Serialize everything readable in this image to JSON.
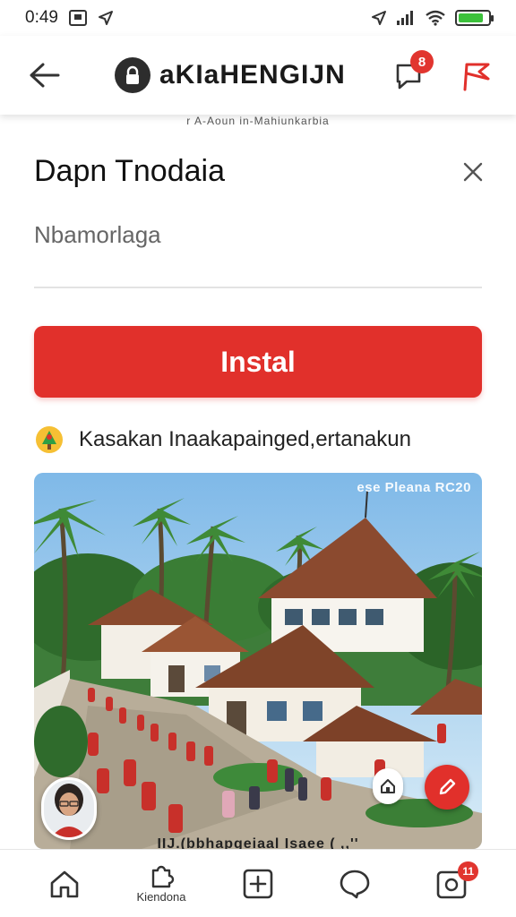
{
  "status_bar": {
    "time": "0:49",
    "icons": [
      "notification-icon",
      "location-arrow-icon"
    ],
    "right_icons": [
      "location-arrow-icon",
      "signal-icon",
      "wifi-icon",
      "battery-icon"
    ],
    "battery_level": 0.85
  },
  "app_bar": {
    "title": "aKIaHENGIJN",
    "back_icon": "arrow-left-icon",
    "notification_badge": "8",
    "actions": [
      "chat-icon",
      "flag-icon"
    ]
  },
  "subheader": {
    "text": "r A-Aoun in-Mahiunkarbia"
  },
  "dialog": {
    "title": "Dapn Tnodaia",
    "subtitle": "Nbamorlaga",
    "install_label": "Instal",
    "info_text": "Kasakan Inaakapainged,ertanakun"
  },
  "image_card": {
    "watermark": "ese Pleana RC20",
    "caption": "IIJ.(bbhapgeiaal Isaee ( ,,''"
  },
  "bottom_nav": {
    "items": [
      {
        "label": "",
        "icon": "home-icon"
      },
      {
        "label": "Kiendona",
        "icon": "puzzle-icon"
      },
      {
        "label": "",
        "icon": "add-square-icon"
      },
      {
        "label": "",
        "icon": "chat-bubble-icon"
      },
      {
        "label": "",
        "icon": "bell-square-icon",
        "badge": "11"
      }
    ]
  },
  "colors": {
    "accent": "#e1302b",
    "badge": "#e1352f",
    "battery": "#3cc13b"
  }
}
